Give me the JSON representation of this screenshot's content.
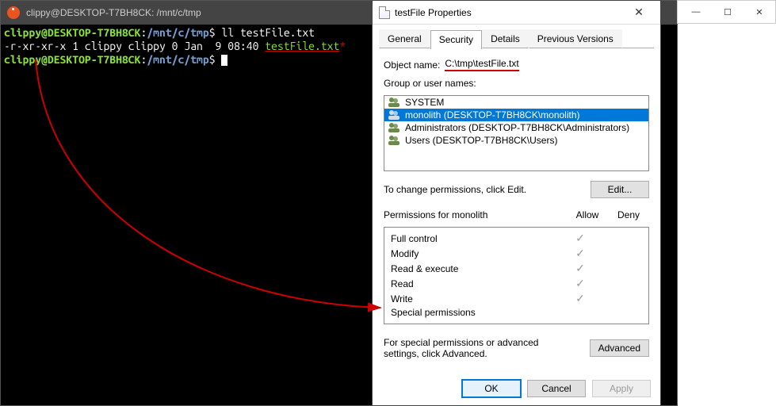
{
  "terminal": {
    "title": "clippy@DESKTOP-T7BH8CK: /mnt/c/tmp",
    "prompt_user": "clippy@DESKTOP-T7BH8CK",
    "prompt_path": "/mnt/c/tmp",
    "cmd1": "ll testFile.txt",
    "ls_perms": "-r-xr-xr-x 1 clippy clippy 0 Jan  9 08:40 ",
    "ls_file": "testFile.txt",
    "asterisk": "*"
  },
  "blank_controls": {
    "min": "—",
    "max": "☐",
    "close": "✕"
  },
  "props": {
    "title": "testFile Properties",
    "tabs": {
      "general": "General",
      "security": "Security",
      "details": "Details",
      "previous": "Previous Versions"
    },
    "object_label": "Object name:",
    "object_path": "C:\\tmp\\testFile.txt",
    "group_label": "Group or user names:",
    "principals": [
      {
        "name": "SYSTEM"
      },
      {
        "name": "monolith (DESKTOP-T7BH8CK\\monolith)"
      },
      {
        "name": "Administrators (DESKTOP-T7BH8CK\\Administrators)"
      },
      {
        "name": "Users (DESKTOP-T7BH8CK\\Users)"
      }
    ],
    "selected_index": 1,
    "edit_hint": "To change permissions, click Edit.",
    "edit_btn": "Edit...",
    "perm_label": "Permissions for monolith",
    "col_allow": "Allow",
    "col_deny": "Deny",
    "perms": [
      {
        "name": "Full control",
        "allow": true,
        "deny": false
      },
      {
        "name": "Modify",
        "allow": true,
        "deny": false
      },
      {
        "name": "Read & execute",
        "allow": true,
        "deny": false
      },
      {
        "name": "Read",
        "allow": true,
        "deny": false
      },
      {
        "name": "Write",
        "allow": true,
        "deny": false
      },
      {
        "name": "Special permissions",
        "allow": false,
        "deny": false
      }
    ],
    "adv_text": "For special permissions or advanced settings, click Advanced.",
    "adv_btn": "Advanced",
    "ok": "OK",
    "cancel": "Cancel",
    "apply": "Apply"
  },
  "annotation": {
    "color": "#cc0000"
  }
}
